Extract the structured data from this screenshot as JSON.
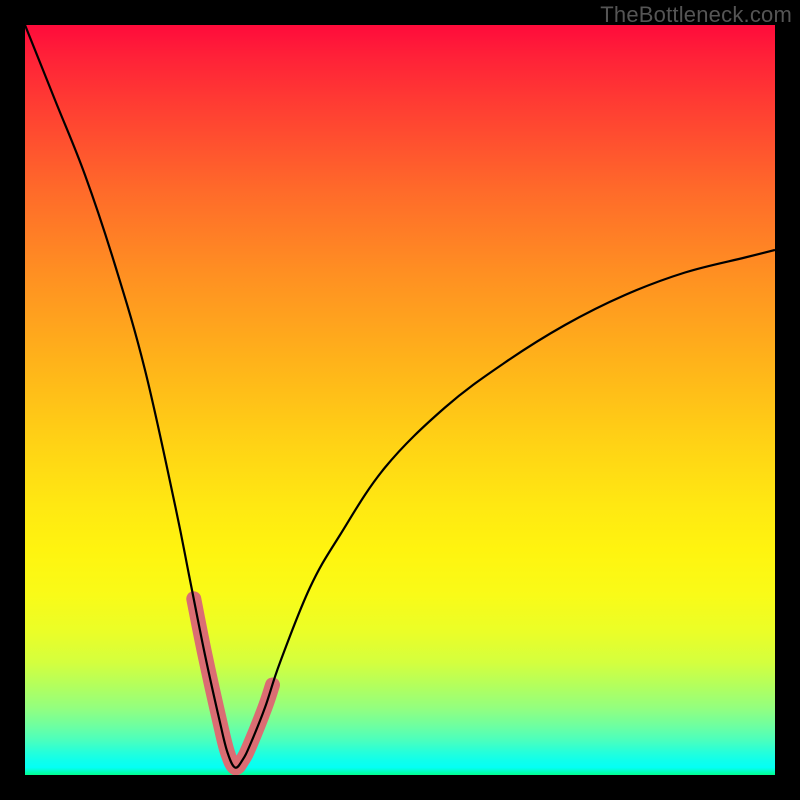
{
  "watermark": "TheBottleneck.com",
  "colors": {
    "frame_bg": "#000000",
    "curve": "#000000",
    "highlight": "#db6d73",
    "gradient_top": "#ff0b3b",
    "gradient_bottom": "#00ff8f"
  },
  "chart_data": {
    "type": "line",
    "title": "",
    "xlabel": "",
    "ylabel": "",
    "xlim": [
      0,
      100
    ],
    "ylim": [
      0,
      100
    ],
    "notes": "Bottleneck-style V-curve. y≈0 at minimum near x≈28; rises steeply toward both sides; highlighted band marks the near-zero region around the minimum.",
    "x": [
      0,
      4,
      8,
      12,
      16,
      20,
      22,
      24,
      26,
      27,
      28,
      29,
      30,
      32,
      34,
      38,
      42,
      48,
      56,
      64,
      72,
      80,
      88,
      96,
      100
    ],
    "values": [
      100,
      90,
      80,
      68,
      54,
      36,
      26,
      16,
      7,
      3,
      1,
      2,
      4,
      9,
      15,
      25,
      32,
      41,
      49,
      55,
      60,
      64,
      67,
      69,
      70
    ],
    "highlight_range_x": [
      22.5,
      33
    ],
    "minimum": {
      "x": 28,
      "y": 1
    }
  }
}
